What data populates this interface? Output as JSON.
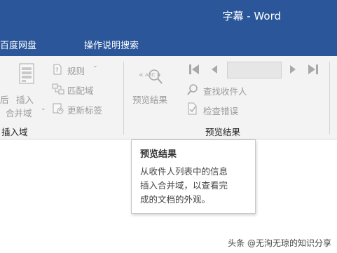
{
  "window": {
    "title": "字幕  -  Word"
  },
  "tellbar": {
    "baidu_label": "百度网盘",
    "search_label": "操作说明搜索"
  },
  "ribbon": {
    "insert_group": {
      "insert_field_line1": "插入",
      "insert_field_line2": "合并域",
      "rules_label": "规则",
      "match_fields_label": "匹配域",
      "update_labels_label": "更新标签",
      "group_label": "插入域",
      "partial_left_label": "后"
    },
    "preview_group": {
      "preview_results_label": "预览结果",
      "find_recipient_label": "查找收件人",
      "check_errors_label": "检查错误",
      "group_label": "预览结果"
    }
  },
  "tooltip": {
    "title": "预览结果",
    "line1": "从收件人列表中的信息",
    "line2": "插入合并域，以查看完",
    "line3": "成的文档的外观。"
  },
  "watermark": "头条 @无洵无琼的知识分享",
  "colors": {
    "titlebar": "#2b579a",
    "ribbon": "#f3f3f3"
  }
}
